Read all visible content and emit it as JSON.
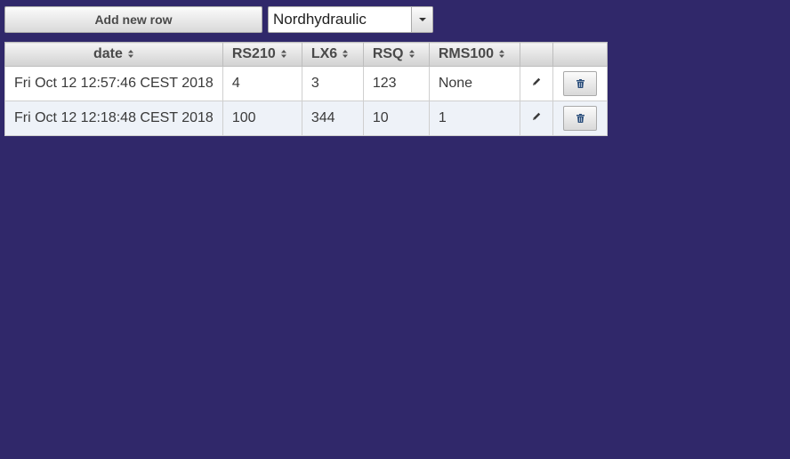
{
  "toolbar": {
    "add_row_label": "Add new row",
    "selector_value": "Nordhydraulic"
  },
  "grid": {
    "columns": [
      {
        "label": "date",
        "icon": "sort-icon"
      },
      {
        "label": "RS210",
        "icon": "sort-icon"
      },
      {
        "label": "LX6",
        "icon": "sort-icon"
      },
      {
        "label": "RSQ",
        "icon": "sort-icon"
      },
      {
        "label": "RMS100",
        "icon": "sort-icon"
      },
      {
        "label": ""
      },
      {
        "label": ""
      }
    ],
    "rows": [
      {
        "date": "Fri Oct 12 12:57:46 CEST 2018",
        "RS210": "4",
        "LX6": "3",
        "RSQ": "123",
        "RMS100": "None"
      },
      {
        "date": "Fri Oct 12 12:18:48 CEST 2018",
        "RS210": "100",
        "LX6": "344",
        "RSQ": "10",
        "RMS100": "1"
      }
    ],
    "row_actions": {
      "edit_icon": "pencil-icon",
      "delete_icon": "trash-icon"
    }
  },
  "colors": {
    "background": "#30286a",
    "alt_row": "#eef2f8"
  }
}
